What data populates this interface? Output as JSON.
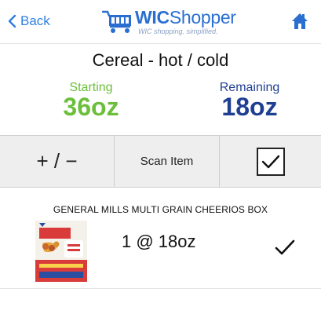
{
  "header": {
    "back_label": "Back",
    "brand_bold": "WIC",
    "brand_rest": "Shopper",
    "tagline": "WIC shopping. simplified."
  },
  "category": {
    "title": "Cereal - hot / cold",
    "starting_label": "Starting",
    "starting_value": "36oz",
    "remaining_label": "Remaining",
    "remaining_value": "18oz"
  },
  "actions": {
    "adjust_label": "+ / −",
    "scan_label": "Scan Item"
  },
  "items": [
    {
      "name": "GENERAL MILLS MULTI GRAIN CHEERIOS BOX",
      "quantity": "1 @ 18oz"
    }
  ],
  "colors": {
    "accent_blue": "#2f7fe0",
    "starting_green": "#6bbf3a",
    "remaining_navy": "#1f3f93"
  },
  "icons": {
    "back": "chevron-left-icon",
    "logo": "shopping-cart-icon",
    "home": "home-icon",
    "confirm": "checkmark-icon"
  }
}
